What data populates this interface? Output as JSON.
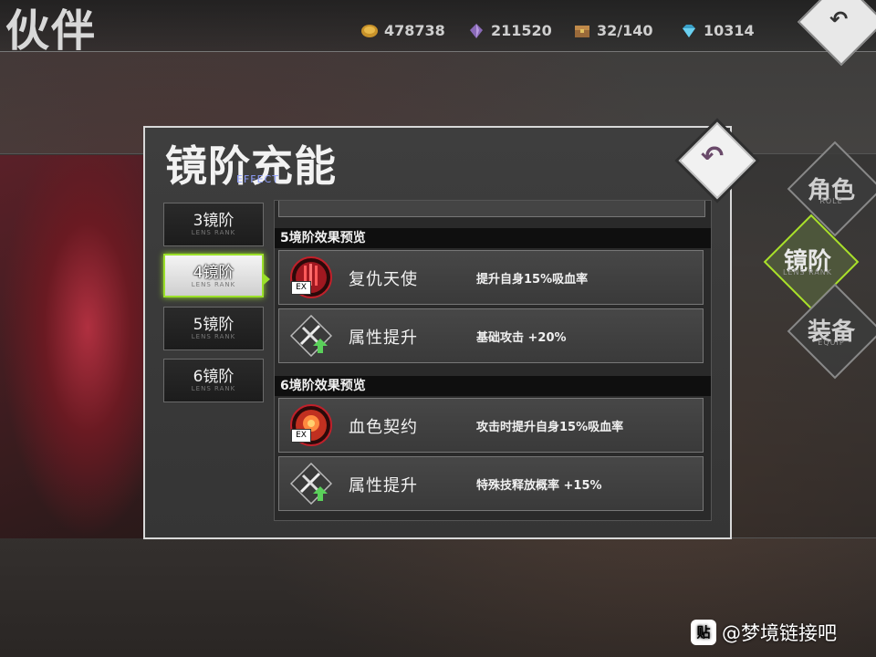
{
  "background": {
    "title": "伙伴",
    "resources": [
      {
        "icon": "gold-coin-icon",
        "value": "478738"
      },
      {
        "icon": "purple-crystal-icon",
        "value": "211520"
      },
      {
        "icon": "treasure-chest-icon",
        "value": "32/140"
      },
      {
        "icon": "blue-diamond-icon",
        "value": "10314"
      }
    ],
    "side_tabs": [
      {
        "label": "角色",
        "sub": "ROLE"
      },
      {
        "label": "镜阶",
        "sub": "LENS RANK"
      },
      {
        "label": "装备",
        "sub": "EQUIP"
      }
    ]
  },
  "modal": {
    "title": "镜阶充能",
    "subtitle": "EFFECT",
    "close_glyph": "↶",
    "ranks": [
      {
        "label": "3镜阶",
        "sub": "LENS RANK",
        "active": false
      },
      {
        "label": "4镜阶",
        "sub": "LENS RANK",
        "active": true
      },
      {
        "label": "5镜阶",
        "sub": "LENS RANK",
        "active": false
      },
      {
        "label": "6镜阶",
        "sub": "LENS RANK",
        "active": false
      }
    ],
    "sections": [
      {
        "header": "5境阶效果预览",
        "items": [
          {
            "icon": "blood-angel-ex-skill-icon",
            "ex": "EX",
            "name": "复仇天使",
            "desc": "提升自身15%吸血率"
          },
          {
            "icon": "attribute-up-swords-icon",
            "name": "属性提升",
            "desc": "基础攻击 +20%"
          }
        ]
      },
      {
        "header": "6境阶效果预览",
        "items": [
          {
            "icon": "blood-contract-ex-skill-icon",
            "ex": "EX",
            "name": "血色契约",
            "desc": "攻击时提升自身15%吸血率"
          },
          {
            "icon": "attribute-up-swords-icon",
            "name": "属性提升",
            "desc": "特殊技释放概率 +15%"
          }
        ]
      }
    ]
  },
  "watermark": {
    "logo": "贴",
    "text": "@梦境链接吧"
  },
  "colors": {
    "accent": "#9be02a",
    "modal_border": "#d8d8d8",
    "skill_red": "#c0202a"
  }
}
